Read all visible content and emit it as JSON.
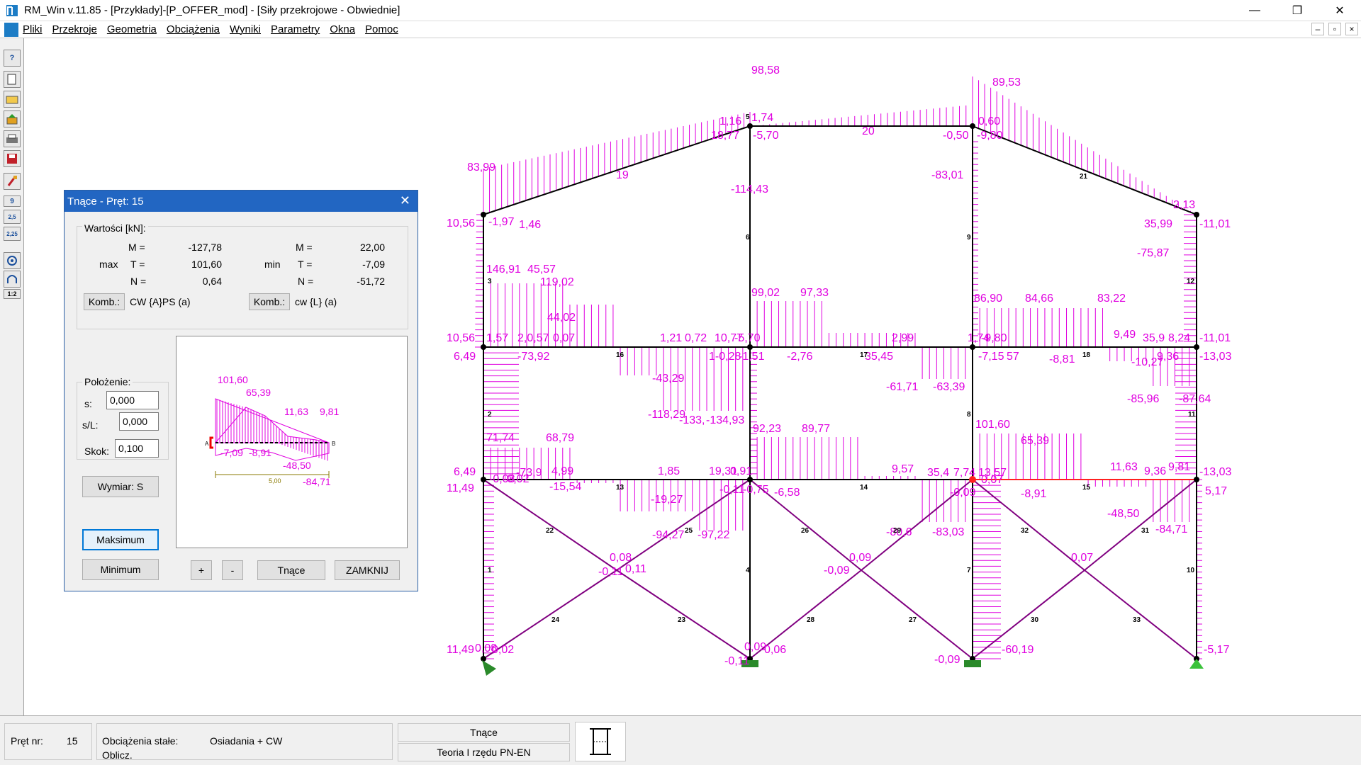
{
  "window": {
    "title": "RM_Win v.11.85 - [Przykłady]-[P_OFFER_mod] - [Siły przekrojowe - Obwiednie]",
    "minimize": "—",
    "restore": "❐",
    "close": "✕"
  },
  "menu": {
    "items": [
      "Pliki",
      "Przekroje",
      "Geometria",
      "Obciążenia",
      "Wyniki",
      "Parametry",
      "Okna",
      "Pomoc"
    ],
    "mdi": [
      "–",
      "▫",
      "×"
    ]
  },
  "toolbar": {
    "labels": [
      "?",
      "9",
      "2,5",
      "2,25",
      "1:2"
    ]
  },
  "dialog": {
    "title": "Tnące - Pręt: 15",
    "values_header": "Wartości [kN]:",
    "max_label": "max",
    "min_label": "min",
    "max": {
      "M_label": "M =",
      "T_label": "T =",
      "N_label": "N =",
      "M": "-127,78",
      "T": "101,60",
      "N": "0,64"
    },
    "min": {
      "M_label": "M =",
      "T_label": "T =",
      "N_label": "N =",
      "M": "22,00",
      "T": "-7,09",
      "N": "-51,72"
    },
    "komb_button": "Komb.:",
    "komb_max": "CW {A}PS (a)",
    "komb_min": "cw {L} (a)",
    "position_header": "Położenie:",
    "s_label": "s:",
    "s_value": "0,000",
    "sl_label": "s/L:",
    "sl_value": "0,000",
    "step_label": "Skok:",
    "step_value": "0,100",
    "dim_button": "Wymiar: S",
    "max_button": "Maksimum",
    "min_button": "Minimum",
    "plus_button": "+",
    "minus_button": "-",
    "shear_button": "Tnące",
    "close_button": "ZAMKNIJ",
    "preview_labels": [
      "101,60",
      "65,39",
      "11,63",
      "9,81",
      "-7,09",
      "-8,91",
      "-48,50",
      "-84,71",
      "5,00",
      "A",
      "B"
    ]
  },
  "statusbar": {
    "bar_label": "Pręt nr:",
    "bar_value": "15",
    "loads_label": "Obciążenia stałe:",
    "loads_value": "Osiadania + CW",
    "calc_label": "Oblicz.",
    "result_type": "Tnące",
    "theory": "Teoria I rzędu PN-EN"
  },
  "diagram": {
    "magenta": "#e000e0",
    "frame": "#000000",
    "brace": "#800080",
    "labels": [
      "98,58",
      "89,53",
      "1,16",
      "1,74",
      "0,60",
      "18,77",
      "-5,70",
      "-0,50",
      "-9,80",
      "83,99",
      "-114,43",
      "-83,01",
      "2,13",
      "10,56",
      "-1,97",
      "1,46",
      "35,99",
      "-11,01",
      "-75,87",
      "146,91",
      "45,57",
      "119,02",
      "44,02",
      "99,02",
      "97,33",
      "86,90",
      "84,66",
      "83,22",
      "10,56",
      "1,57",
      "2,0,57",
      "0,07",
      "1,21",
      "0,72",
      "10,77",
      "-5,70",
      "2,99",
      "1,74",
      "-9,80",
      "9,49",
      "35,9",
      "8,24",
      "-11,01",
      "6,49",
      "-73,92",
      "1-0,28",
      "-1,51",
      "-2,76",
      "35,45",
      "-7,15",
      "57",
      "-8,81",
      "-10,27",
      "9,36",
      "-13,03",
      "-43,29",
      "-61,71",
      "-63,39",
      "-85,96",
      "-87,64",
      "-118,29",
      "-133,",
      "-134,93",
      "92,23",
      "89,77",
      "101,60",
      "65,39",
      "71,74",
      "68,79",
      "4,99",
      "1,85",
      "19,31",
      "0,91",
      "9,57",
      "35,4",
      "7,74",
      "13,57",
      "11,63",
      "9,36",
      "9,81",
      "6,49",
      "-0,08",
      "-0,02",
      "-73,9",
      "-15,54",
      "-19,27",
      "-0,11",
      "-0,75",
      "-6,58",
      "-0,09",
      "0,07",
      "-8,91",
      "-48,50",
      "-84,71",
      "-13,03",
      "5,17",
      "11,49",
      "-94,27",
      "-97,22",
      "-80,6",
      "-83,03",
      "0,08",
      "0,11",
      "-0,11",
      "0,09",
      "-0,09",
      "0,07",
      "11,49",
      "0,08",
      "0,02",
      "0,09",
      "0,06",
      "-0,11",
      "-0,09",
      "-60,19",
      "-5,17",
      "19",
      "20",
      "21",
      "16",
      "17",
      "18",
      "13",
      "14",
      "15",
      "22",
      "25",
      "26",
      "29",
      "32",
      "31",
      "24",
      "23",
      "28",
      "27",
      "30",
      "33",
      "1",
      "2",
      "3",
      "4",
      "6",
      "5",
      "9",
      "8",
      "7",
      "11",
      "12",
      "10"
    ]
  }
}
